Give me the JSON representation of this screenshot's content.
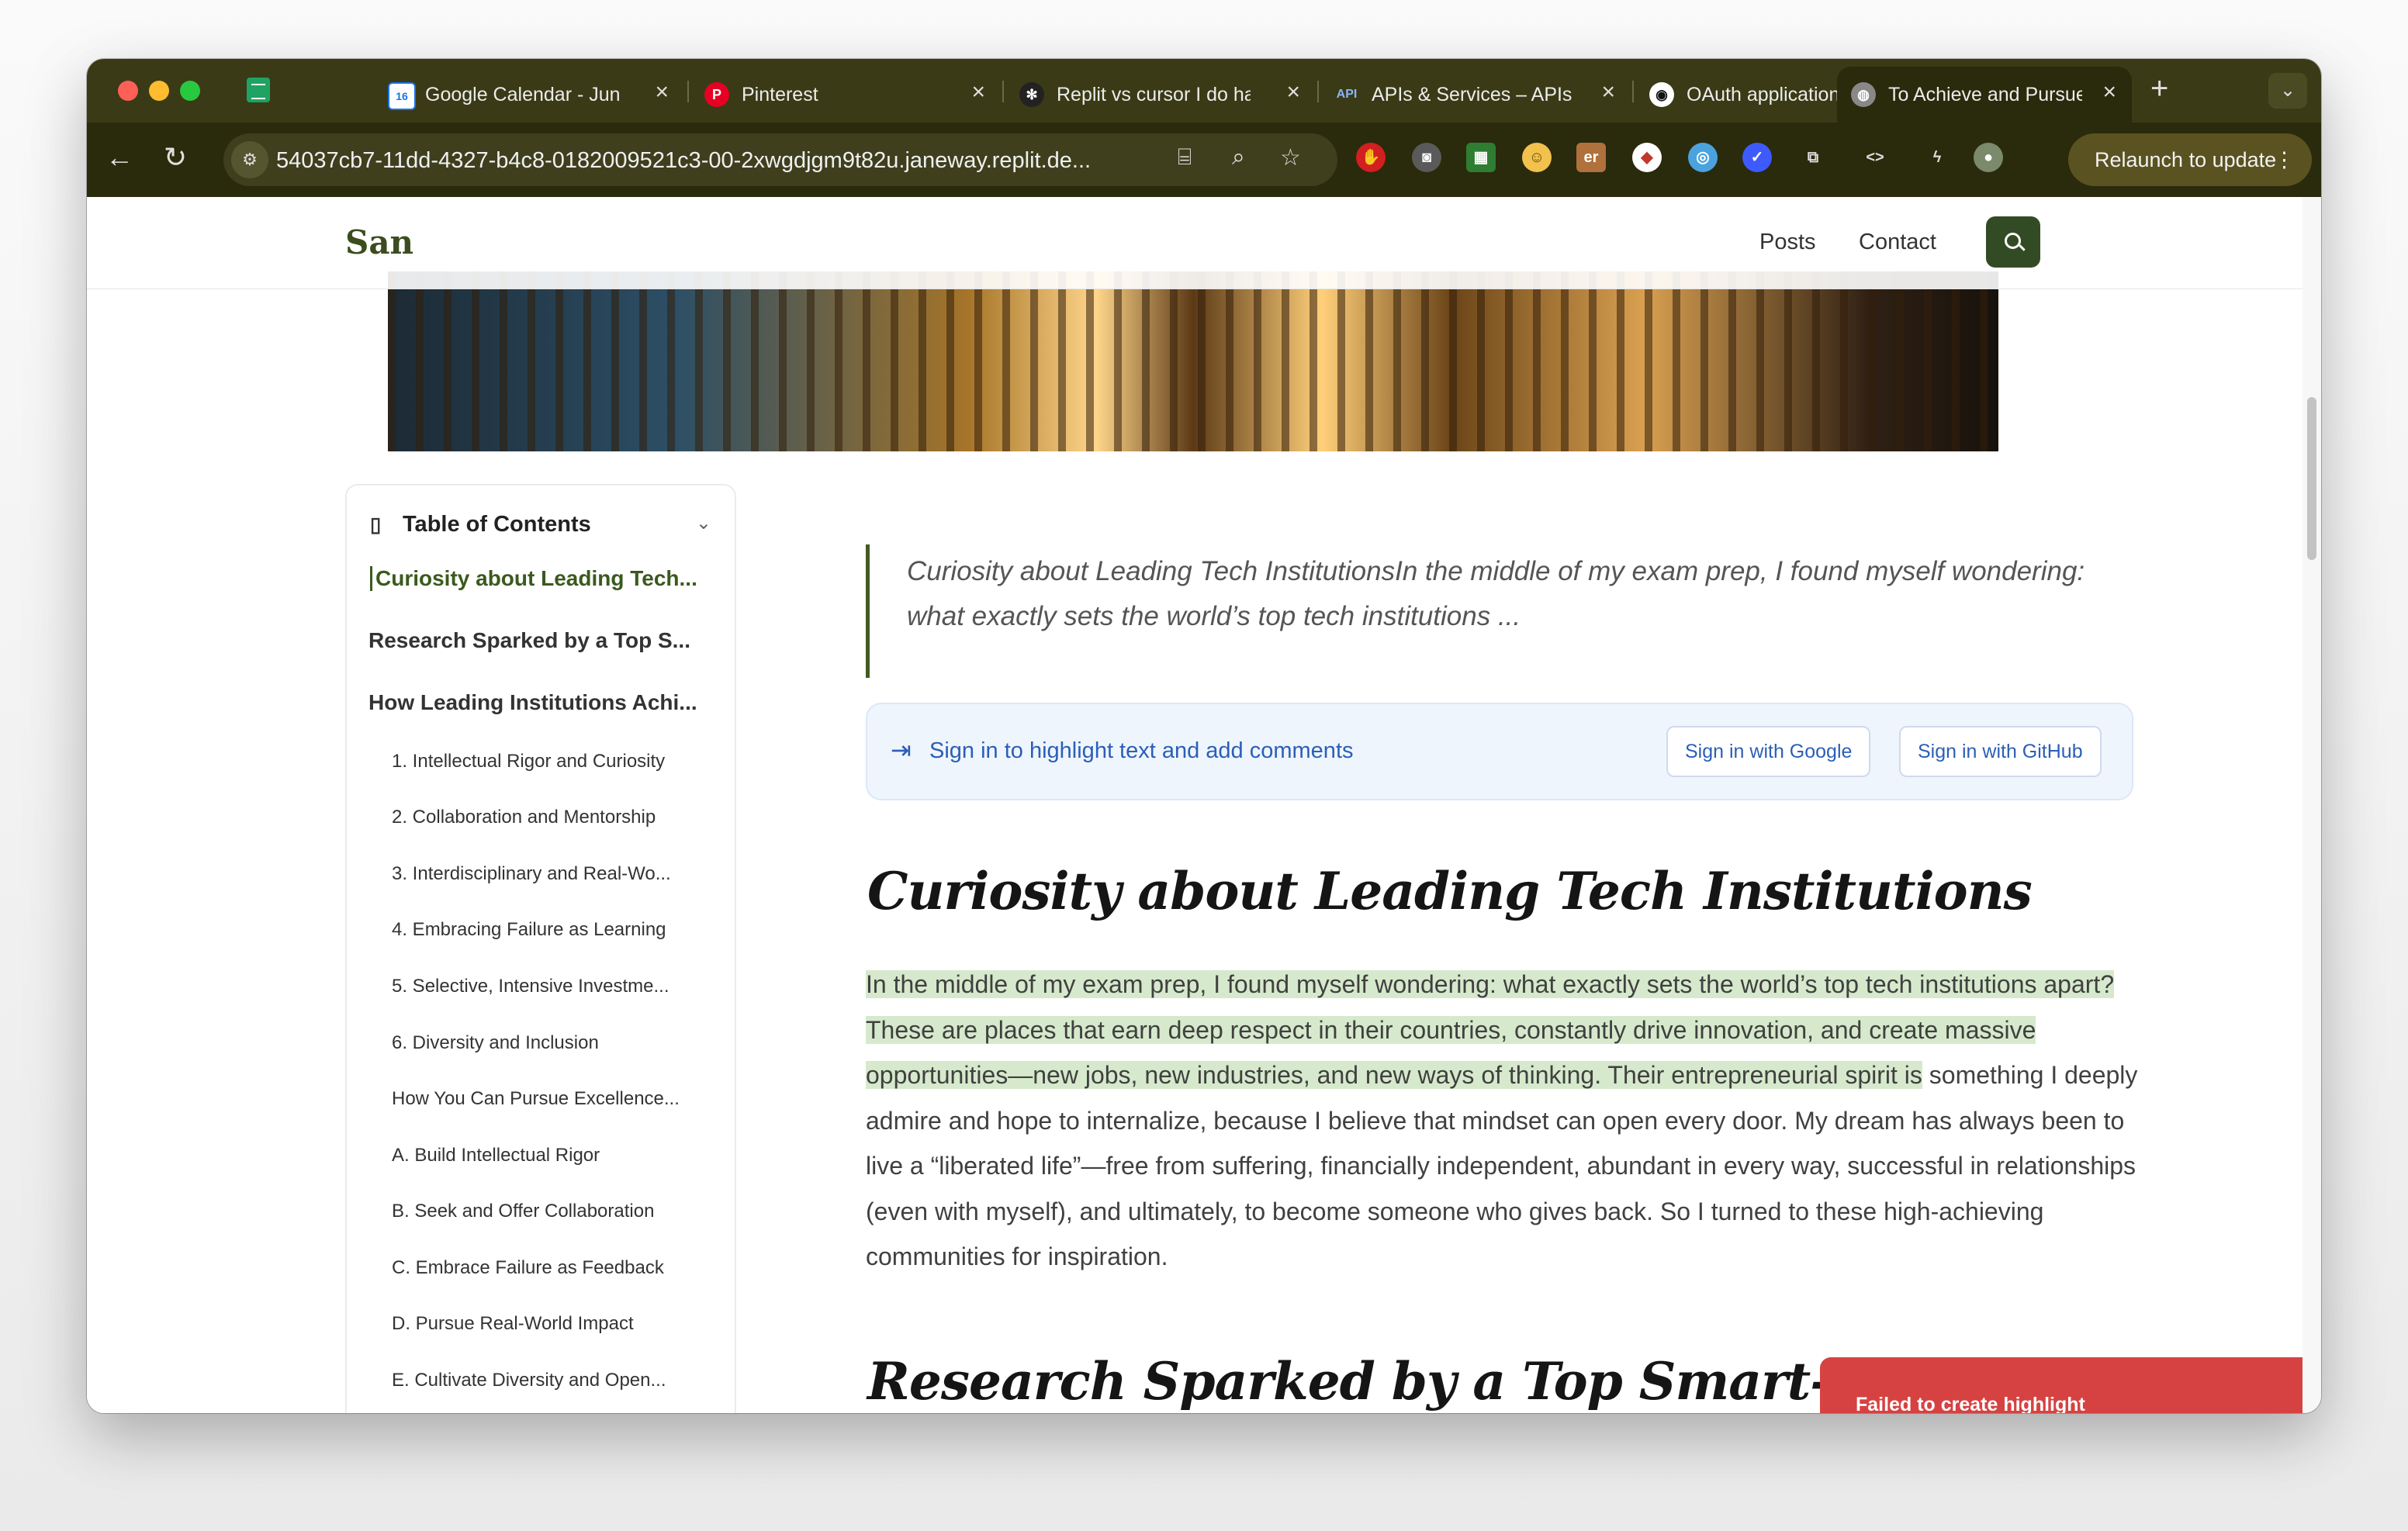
{
  "browser": {
    "tabs": [
      {
        "title": "Google Calendar - Jun",
        "favicon": "calendar-icon"
      },
      {
        "title": "Pinterest",
        "favicon": "pinterest-icon"
      },
      {
        "title": "Replit vs cursor I do ha",
        "favicon": "replit-icon"
      },
      {
        "title": "APIs & Services – APIs",
        "favicon": "api-icon"
      },
      {
        "title": "OAuth application sett",
        "favicon": "github-icon"
      },
      {
        "title": "To Achieve and Pursue",
        "favicon": "globe-icon"
      }
    ],
    "api_badge": "API",
    "calendar_badge": "16",
    "url": "54037cb7-11dd-4327-b4c8-0182009521c3-00-2xwgdjgm9t82u.janeway.replit.de...",
    "relaunch_label": "Relaunch to update",
    "colors": {
      "frame": "#2a2a0c",
      "tabstrip": "#3a3a16"
    }
  },
  "site": {
    "logo": "San",
    "nav": [
      "Posts",
      "Contact"
    ],
    "accent": "#334b24"
  },
  "toc": {
    "title": "Table of Contents",
    "items": [
      {
        "label": "Curiosity about Leading Tech...",
        "level": 1,
        "active": true
      },
      {
        "label": "Research Sparked by a Top S...",
        "level": 1
      },
      {
        "label": "How Leading Institutions Achi...",
        "level": 1
      },
      {
        "label": "1. Intellectual Rigor and Curiosity",
        "level": 2
      },
      {
        "label": "2. Collaboration and Mentorship",
        "level": 2
      },
      {
        "label": "3. Interdisciplinary and Real-Wo...",
        "level": 2
      },
      {
        "label": "4. Embracing Failure as Learning",
        "level": 2
      },
      {
        "label": "5. Selective, Intensive Investme...",
        "level": 2
      },
      {
        "label": "6. Diversity and Inclusion",
        "level": 2
      },
      {
        "label": "How You Can Pursue Excellence...",
        "level": 2
      },
      {
        "label": "A. Build Intellectual Rigor",
        "level": 2
      },
      {
        "label": "B. Seek and Offer Collaboration",
        "level": 2
      },
      {
        "label": "C. Embrace Failure as Feedback",
        "level": 2
      },
      {
        "label": "D. Pursue Real-World Impact",
        "level": 2
      },
      {
        "label": "E. Cultivate Diversity and Open...",
        "level": 2
      }
    ]
  },
  "article": {
    "excerpt": "Curiosity about Leading Tech InstitutionsIn the middle of my exam prep, I found myself wondering: what exactly sets the world’s top tech institutions ...",
    "signin": {
      "message": "Sign in to highlight text and add comments",
      "google": "Sign in with Google",
      "github": "Sign in with GitHub"
    },
    "heading1": "Curiosity about Leading Tech Institutions",
    "para_highlighted": "In the middle of my exam prep, I found myself wondering: what exactly sets the world’s top tech institutions apart? These are places that earn deep respect in their countries, constantly drive innovation, and create massive opportunities—new jobs, new industries, and new ways of thinking. Their entrepreneurial spirit is",
    "para_rest": " something I deeply admire and hope to internalize, because I believe that mindset can open every door. My dream has always been to live a “liberated life”—free from suffering, financially independent, abundant in every way, successful in relationships (even with myself), and ultimately, to become someone who gives back. So I turned to these high-achieving communities for inspiration.",
    "heading2": "Research Sparked by a Top Smart-Farm S"
  },
  "toast": {
    "message": "Failed to create highlight",
    "color": "#d64242"
  }
}
